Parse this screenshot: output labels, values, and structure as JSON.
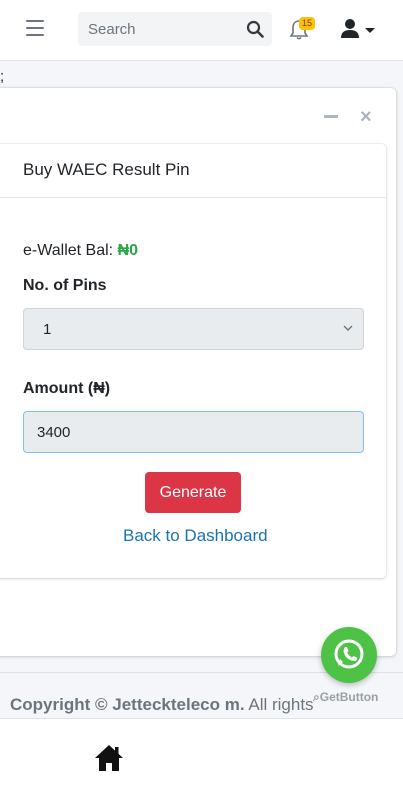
{
  "header": {
    "search_placeholder": "Search",
    "notification_count": "15"
  },
  "stray_text": ";",
  "card": {
    "title": "Buy WAEC Result Pin",
    "wallet_label": "e-Wallet Bal:",
    "wallet_value": "₦0",
    "pins_label": "No. of Pins",
    "pins_selected": "1",
    "amount_label": "Amount (₦)",
    "amount_value": "3400",
    "generate_label": "Generate",
    "back_link": "Back to Dashboard"
  },
  "footer": {
    "copyright_prefix": "Copyright ©",
    "company": "Jetteckteleco m.",
    "company_full": "Jetteckteleco m.",
    "rights": "All rights"
  },
  "widget": {
    "getbutton_label": "GetButton"
  },
  "colors": {
    "wallet_value": "#28a745",
    "generate_button": "#dc3545",
    "link": "#1a73b5",
    "whatsapp": "#4dc247",
    "badge": "#ffc107"
  },
  "icons": [
    "menu-icon",
    "search-icon",
    "bell-icon",
    "user-icon",
    "caret-down-icon",
    "minimize-icon",
    "close-icon",
    "chevron-down-icon",
    "home-icon",
    "whatsapp-icon"
  ]
}
